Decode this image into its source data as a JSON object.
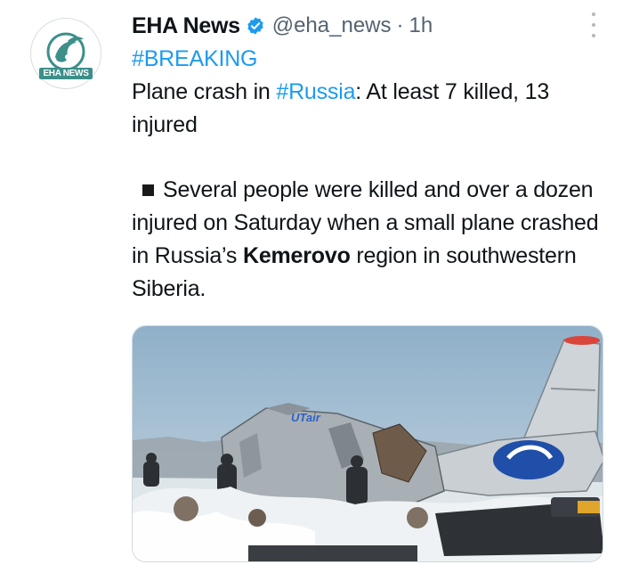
{
  "tweet": {
    "author_name": "EHA News",
    "verified": true,
    "handle": "@eha_news",
    "separator": "·",
    "time": "1h",
    "avatar_label": "EHA NEWS",
    "hashtag_breaking": "#BREAKING",
    "headline_prefix": "Plane crash in ",
    "hashtag_russia": "#Russia",
    "headline_suffix": ": At least 7 killed, 13 injured",
    "body_prefix": "Several people were killed and over a dozen injured on Saturday when a small plane crashed in Russia’s ",
    "body_bold": "Kemerovo",
    "body_suffix": " region in southwestern Siberia."
  },
  "media": {
    "fuselage_lettering": "UTair",
    "description_icon": "crashed-plane-photo"
  },
  "colors": {
    "link": "#1d9bf0",
    "muted": "#536471",
    "verified": "#1d9bf0",
    "brand": "#3d8f8a"
  }
}
